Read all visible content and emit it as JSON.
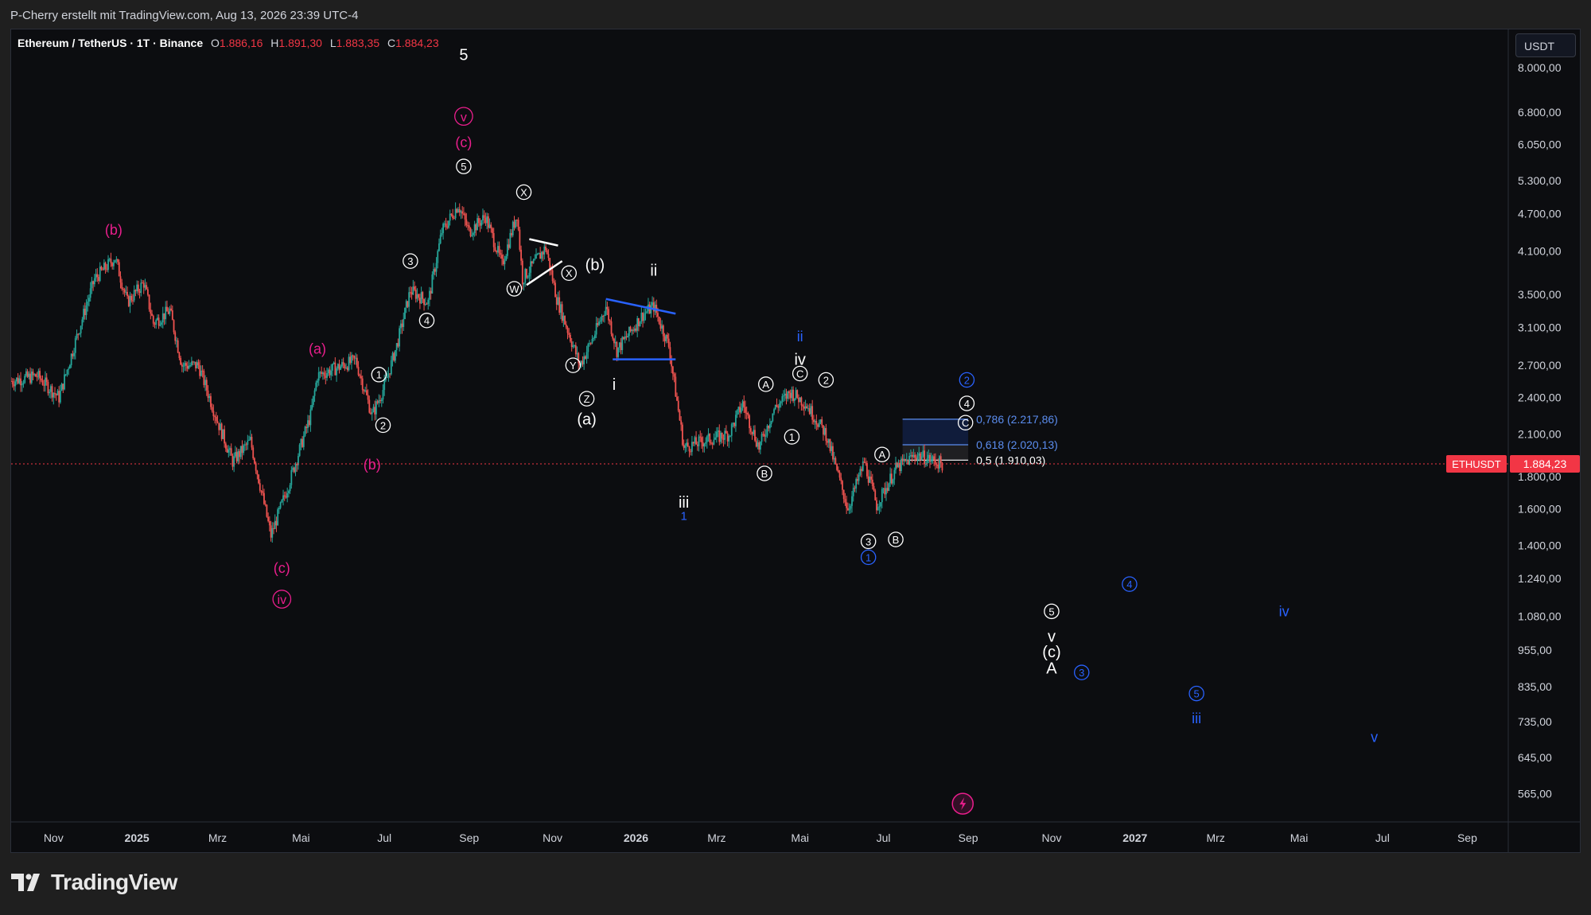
{
  "header": {
    "credit": "P-Cherry erstellt mit TradingView.com, Aug 13, 2026 23:39 UTC-4"
  },
  "legend": {
    "symbol": "Ethereum / TetherUS · 1T · Binance",
    "open_label": "O",
    "open": "1.886,16",
    "high_label": "H",
    "high": "1.891,30",
    "low_label": "L",
    "low": "1.883,35",
    "close_label": "C",
    "close": "1.884,23"
  },
  "price_axis": {
    "unit_button": "USDT"
  },
  "current_price": {
    "ticker": "ETHUSDT",
    "value": "1.884,23"
  },
  "fib_levels": [
    {
      "label": "0,786 (2.217,86)",
      "price": 2217.86,
      "color": "#5b8def"
    },
    {
      "label": "0,618 (2.020,13)",
      "price": 2020.13,
      "color": "#5b8def"
    },
    {
      "label": "0,5 (1.910,03)",
      "price": 1910.03,
      "color": "#ffffff"
    }
  ],
  "footer": {
    "brand": "TradingView"
  },
  "colors": {
    "up": "#26a69a",
    "down": "#ef5350",
    "magenta": "#e91e8c",
    "blue": "#2962ff",
    "price_tag": "#f23645"
  },
  "chart_data": {
    "type": "candlestick",
    "y_scale": "log",
    "ylim": [
      510,
      9200
    ],
    "xlim": [
      "2024-10-01",
      "2027-10-01"
    ],
    "y_ticks": [
      {
        "value": 8000,
        "label": "8.000,00"
      },
      {
        "value": 6800,
        "label": "6.800,00"
      },
      {
        "value": 6050,
        "label": "6.050,00"
      },
      {
        "value": 5300,
        "label": "5.300,00"
      },
      {
        "value": 4700,
        "label": "4.700,00"
      },
      {
        "value": 4100,
        "label": "4.100,00"
      },
      {
        "value": 3500,
        "label": "3.500,00"
      },
      {
        "value": 3100,
        "label": "3.100,00"
      },
      {
        "value": 2700,
        "label": "2.700,00"
      },
      {
        "value": 2400,
        "label": "2.400,00"
      },
      {
        "value": 2100,
        "label": "2.100,00"
      },
      {
        "value": 1800,
        "label": "1.800,00"
      },
      {
        "value": 1600,
        "label": "1.600,00"
      },
      {
        "value": 1400,
        "label": "1.400,00"
      },
      {
        "value": 1240,
        "label": "1.240,00"
      },
      {
        "value": 1080,
        "label": "1.080,00"
      },
      {
        "value": 955,
        "label": "955,00"
      },
      {
        "value": 835,
        "label": "835,00"
      },
      {
        "value": 735,
        "label": "735,00"
      },
      {
        "value": 645,
        "label": "645,00"
      },
      {
        "value": 565,
        "label": "565,00"
      }
    ],
    "x_ticks": [
      {
        "date": "2024-11-01",
        "label": "Nov",
        "bold": false
      },
      {
        "date": "2025-01-01",
        "label": "2025",
        "bold": true
      },
      {
        "date": "2025-03-01",
        "label": "Mrz",
        "bold": false
      },
      {
        "date": "2025-05-01",
        "label": "Mai",
        "bold": false
      },
      {
        "date": "2025-07-01",
        "label": "Jul",
        "bold": false
      },
      {
        "date": "2025-09-01",
        "label": "Sep",
        "bold": false
      },
      {
        "date": "2025-11-01",
        "label": "Nov",
        "bold": false
      },
      {
        "date": "2026-01-01",
        "label": "2026",
        "bold": true
      },
      {
        "date": "2026-03-01",
        "label": "Mrz",
        "bold": false
      },
      {
        "date": "2026-05-01",
        "label": "Mai",
        "bold": false
      },
      {
        "date": "2026-07-01",
        "label": "Jul",
        "bold": false
      },
      {
        "date": "2026-09-01",
        "label": "Sep",
        "bold": false
      },
      {
        "date": "2026-11-01",
        "label": "Nov",
        "bold": false
      },
      {
        "date": "2027-01-01",
        "label": "2027",
        "bold": true
      },
      {
        "date": "2027-03-01",
        "label": "Mrz",
        "bold": false
      },
      {
        "date": "2027-05-01",
        "label": "Mai",
        "bold": false
      },
      {
        "date": "2027-07-01",
        "label": "Jul",
        "bold": false
      },
      {
        "date": "2027-09-01",
        "label": "Sep",
        "bold": false
      }
    ],
    "price_path": [
      [
        "2024-10-01",
        2550
      ],
      [
        "2024-10-20",
        2600
      ],
      [
        "2024-11-05",
        2400
      ],
      [
        "2024-11-20",
        3100
      ],
      [
        "2024-12-01",
        3700
      ],
      [
        "2024-12-16",
        4000
      ],
      [
        "2024-12-25",
        3400
      ],
      [
        "2025-01-06",
        3650
      ],
      [
        "2025-01-13",
        3150
      ],
      [
        "2025-01-25",
        3300
      ],
      [
        "2025-02-03",
        2700
      ],
      [
        "2025-02-15",
        2700
      ],
      [
        "2025-03-01",
        2200
      ],
      [
        "2025-03-12",
        1900
      ],
      [
        "2025-03-25",
        2050
      ],
      [
        "2025-04-09",
        1450
      ],
      [
        "2025-04-22",
        1750
      ],
      [
        "2025-05-08",
        2250
      ],
      [
        "2025-05-13",
        2600
      ],
      [
        "2025-06-10",
        2750
      ],
      [
        "2025-06-22",
        2250
      ],
      [
        "2025-07-01",
        2500
      ],
      [
        "2025-07-10",
        2900
      ],
      [
        "2025-07-20",
        3550
      ],
      [
        "2025-08-02",
        3400
      ],
      [
        "2025-08-12",
        4400
      ],
      [
        "2025-08-24",
        4850
      ],
      [
        "2025-09-01",
        4400
      ],
      [
        "2025-09-13",
        4650
      ],
      [
        "2025-09-25",
        3900
      ],
      [
        "2025-10-06",
        4700
      ],
      [
        "2025-10-10",
        3700
      ],
      [
        "2025-10-27",
        4150
      ],
      [
        "2025-11-04",
        3450
      ],
      [
        "2025-11-21",
        2700
      ],
      [
        "2025-12-01",
        3000
      ],
      [
        "2025-12-10",
        3350
      ],
      [
        "2025-12-18",
        2850
      ],
      [
        "2026-01-06",
        3250
      ],
      [
        "2026-01-14",
        3350
      ],
      [
        "2026-01-25",
        2900
      ],
      [
        "2026-02-05",
        2000
      ],
      [
        "2026-02-20",
        2050
      ],
      [
        "2026-03-10",
        2100
      ],
      [
        "2026-03-20",
        2350
      ],
      [
        "2026-04-01",
        2000
      ],
      [
        "2026-04-12",
        2300
      ],
      [
        "2026-04-24",
        2450
      ],
      [
        "2026-05-05",
        2350
      ],
      [
        "2026-05-20",
        2100
      ],
      [
        "2026-06-05",
        1600
      ],
      [
        "2026-06-17",
        1900
      ],
      [
        "2026-06-26",
        1620
      ],
      [
        "2026-07-10",
        1850
      ],
      [
        "2026-07-25",
        1950
      ],
      [
        "2026-08-13",
        1884
      ]
    ],
    "wave_labels": [
      {
        "text": "5",
        "date": "2025-08-28",
        "price": 8400,
        "style": "plain",
        "color": "#ffffff",
        "size": 20
      },
      {
        "text": "v",
        "date": "2025-08-28",
        "price": 6700,
        "style": "circle",
        "color": "#e91e8c",
        "size": 16
      },
      {
        "text": "(c)",
        "date": "2025-08-28",
        "price": 6100,
        "style": "plain",
        "color": "#e91e8c",
        "size": 18
      },
      {
        "text": "5",
        "date": "2025-08-28",
        "price": 5580,
        "style": "circle",
        "color": "#ffffff",
        "size": 13
      },
      {
        "text": "(b)",
        "date": "2024-12-15",
        "price": 4430,
        "style": "plain",
        "color": "#e91e8c",
        "size": 18
      },
      {
        "text": "3",
        "date": "2025-07-20",
        "price": 3950,
        "style": "circle",
        "color": "#ffffff",
        "size": 13
      },
      {
        "text": "X",
        "date": "2025-10-11",
        "price": 5080,
        "style": "circle",
        "color": "#ffffff",
        "size": 13
      },
      {
        "text": "X",
        "date": "2025-11-13",
        "price": 3780,
        "style": "circle",
        "color": "#ffffff",
        "size": 13
      },
      {
        "text": "W",
        "date": "2025-10-04",
        "price": 3570,
        "style": "circle",
        "color": "#ffffff",
        "size": 13
      },
      {
        "text": "4",
        "date": "2025-08-01",
        "price": 3180,
        "style": "circle",
        "color": "#ffffff",
        "size": 13
      },
      {
        "text": "(a)",
        "date": "2025-05-13",
        "price": 2870,
        "style": "plain",
        "color": "#e91e8c",
        "size": 18
      },
      {
        "text": "1",
        "date": "2025-06-27",
        "price": 2610,
        "style": "circle",
        "color": "#ffffff",
        "size": 13
      },
      {
        "text": "2",
        "date": "2025-06-30",
        "price": 2170,
        "style": "circle",
        "color": "#ffffff",
        "size": 13
      },
      {
        "text": "(b)",
        "date": "2025-06-22",
        "price": 1880,
        "style": "plain",
        "color": "#e91e8c",
        "size": 18
      },
      {
        "text": "(c)",
        "date": "2025-04-17",
        "price": 1290,
        "style": "plain",
        "color": "#e91e8c",
        "size": 18
      },
      {
        "text": "iv",
        "date": "2025-04-17",
        "price": 1150,
        "style": "circle",
        "color": "#e91e8c",
        "size": 16
      },
      {
        "text": "(b)",
        "date": "2025-12-02",
        "price": 3900,
        "style": "plain",
        "color": "#ffffff",
        "size": 20
      },
      {
        "text": "ii",
        "date": "2026-01-14",
        "price": 3820,
        "style": "plain",
        "color": "#ffffff",
        "size": 20
      },
      {
        "text": "Y",
        "date": "2025-11-16",
        "price": 2700,
        "style": "circle",
        "color": "#ffffff",
        "size": 13
      },
      {
        "text": "Z",
        "date": "2025-11-26",
        "price": 2390,
        "style": "circle",
        "color": "#ffffff",
        "size": 13
      },
      {
        "text": "(a)",
        "date": "2025-11-26",
        "price": 2220,
        "style": "plain",
        "color": "#ffffff",
        "size": 20
      },
      {
        "text": "i",
        "date": "2025-12-16",
        "price": 2520,
        "style": "plain",
        "color": "#ffffff",
        "size": 20
      },
      {
        "text": "iii",
        "date": "2026-02-05",
        "price": 1640,
        "style": "plain",
        "color": "#ffffff",
        "size": 20
      },
      {
        "text": "1",
        "date": "2026-02-05",
        "price": 1560,
        "style": "plain",
        "color": "#2962ff",
        "size": 15
      },
      {
        "text": "ii",
        "date": "2026-05-01",
        "price": 3000,
        "style": "plain",
        "color": "#2962ff",
        "size": 18
      },
      {
        "text": "iv",
        "date": "2026-05-01",
        "price": 2760,
        "style": "plain",
        "color": "#ffffff",
        "size": 20
      },
      {
        "text": "C",
        "date": "2026-05-01",
        "price": 2620,
        "style": "circle",
        "color": "#ffffff",
        "size": 13
      },
      {
        "text": "2",
        "date": "2026-05-20",
        "price": 2560,
        "style": "circle",
        "color": "#ffffff",
        "size": 13
      },
      {
        "text": "A",
        "date": "2026-04-06",
        "price": 2520,
        "style": "circle",
        "color": "#ffffff",
        "size": 13
      },
      {
        "text": "1",
        "date": "2026-04-25",
        "price": 2080,
        "style": "circle",
        "color": "#ffffff",
        "size": 13
      },
      {
        "text": "B",
        "date": "2026-04-05",
        "price": 1820,
        "style": "circle",
        "color": "#ffffff",
        "size": 13
      },
      {
        "text": "A",
        "date": "2026-06-30",
        "price": 1950,
        "style": "circle",
        "color": "#ffffff",
        "size": 13
      },
      {
        "text": "3",
        "date": "2026-06-20",
        "price": 1420,
        "style": "circle",
        "color": "#ffffff",
        "size": 13
      },
      {
        "text": "1",
        "date": "2026-06-20",
        "price": 1340,
        "style": "circle",
        "color": "#2962ff",
        "size": 13
      },
      {
        "text": "B",
        "date": "2026-07-10",
        "price": 1430,
        "style": "circle",
        "color": "#ffffff",
        "size": 13
      },
      {
        "text": "2",
        "date": "2026-08-31",
        "price": 2560,
        "style": "circle",
        "color": "#2962ff",
        "size": 13
      },
      {
        "text": "4",
        "date": "2026-08-31",
        "price": 2350,
        "style": "circle",
        "color": "#ffffff",
        "size": 13
      },
      {
        "text": "C",
        "date": "2026-08-30",
        "price": 2190,
        "style": "circle",
        "color": "#ffffff",
        "size": 13
      },
      {
        "text": "5",
        "date": "2026-11-01",
        "price": 1100,
        "style": "circle",
        "color": "#ffffff",
        "size": 13
      },
      {
        "text": "v",
        "date": "2026-11-01",
        "price": 1005,
        "style": "plain",
        "color": "#ffffff",
        "size": 20
      },
      {
        "text": "(c)",
        "date": "2026-11-01",
        "price": 950,
        "style": "plain",
        "color": "#ffffff",
        "size": 20
      },
      {
        "text": "A",
        "date": "2026-11-01",
        "price": 895,
        "style": "plain",
        "color": "#ffffff",
        "size": 20
      },
      {
        "text": "3",
        "date": "2026-11-23",
        "price": 880,
        "style": "circle",
        "color": "#2962ff",
        "size": 13
      },
      {
        "text": "4",
        "date": "2026-12-28",
        "price": 1215,
        "style": "circle",
        "color": "#2962ff",
        "size": 13
      },
      {
        "text": "5",
        "date": "2027-02-15",
        "price": 815,
        "style": "circle",
        "color": "#2962ff",
        "size": 13
      },
      {
        "text": "iii",
        "date": "2027-02-15",
        "price": 745,
        "style": "plain",
        "color": "#2962ff",
        "size": 18
      },
      {
        "text": "iv",
        "date": "2027-04-20",
        "price": 1100,
        "style": "plain",
        "color": "#2962ff",
        "size": 18
      },
      {
        "text": "v",
        "date": "2027-06-25",
        "price": 695,
        "style": "plain",
        "color": "#2962ff",
        "size": 18
      }
    ],
    "trend_lines": [
      {
        "from": [
          "2025-10-15",
          4280
        ],
        "to": [
          "2025-11-05",
          4180
        ],
        "color": "#ffffff"
      },
      {
        "from": [
          "2025-10-13",
          3620
        ],
        "to": [
          "2025-11-08",
          3950
        ],
        "color": "#ffffff"
      },
      {
        "from": [
          "2025-12-10",
          3440
        ],
        "to": [
          "2026-01-30",
          3260
        ],
        "color": "#2962ff"
      },
      {
        "from": [
          "2025-12-15",
          2760
        ],
        "to": [
          "2026-01-30",
          2760
        ],
        "color": "#2962ff"
      }
    ],
    "fib_box": {
      "start": "2026-07-15",
      "end": "2026-09-01"
    },
    "lightning_marker": {
      "date": "2026-08-28",
      "price": 545
    }
  }
}
